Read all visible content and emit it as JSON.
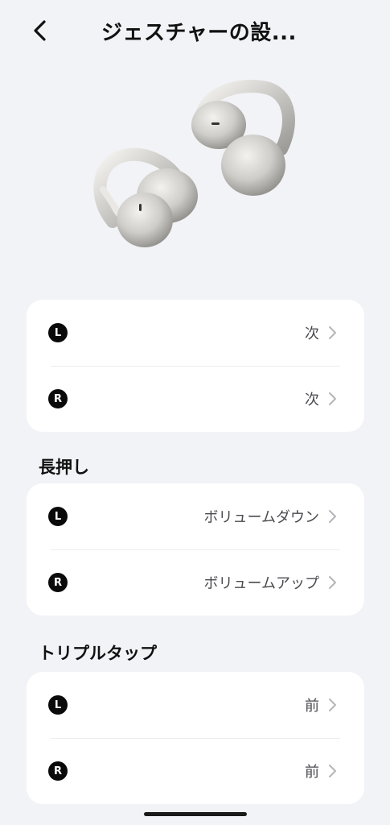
{
  "header": {
    "title": "ジェスチャーの設..."
  },
  "groups": [
    {
      "title": "",
      "rows": [
        {
          "side": "L",
          "value": "次"
        },
        {
          "side": "R",
          "value": "次"
        }
      ]
    },
    {
      "title": "長押し",
      "rows": [
        {
          "side": "L",
          "value": "ボリュームダウン"
        },
        {
          "side": "R",
          "value": "ボリュームアップ"
        }
      ]
    },
    {
      "title": "トリプルタップ",
      "rows": [
        {
          "side": "L",
          "value": "前"
        },
        {
          "side": "R",
          "value": "前"
        }
      ]
    }
  ],
  "colors": {
    "background": "#f2f3f7",
    "card": "#ffffff",
    "badge": "#0a0a0a",
    "value_text": "#4a4a4f",
    "chevron": "#b5b5ba"
  },
  "icons": {
    "back": "chevron-left-icon",
    "row_arrow": "chevron-right-icon",
    "product": "earbuds-image"
  }
}
